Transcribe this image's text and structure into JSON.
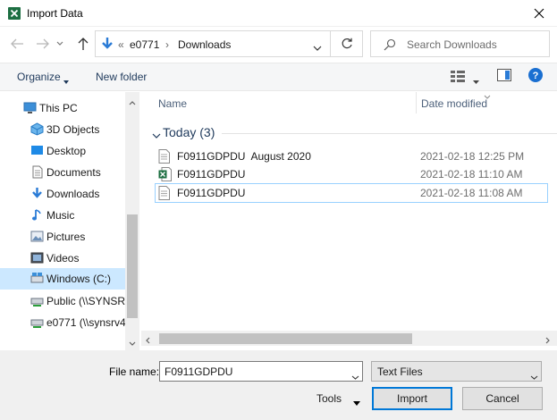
{
  "window": {
    "title": "Import Data"
  },
  "address": {
    "overflow": "«",
    "crumbs": [
      "e0771",
      "Downloads"
    ]
  },
  "search": {
    "placeholder": "Search Downloads"
  },
  "toolbar": {
    "organize": "Organize",
    "new_folder": "New folder"
  },
  "nav": {
    "items": [
      {
        "label": "This PC",
        "icon": "pc-icon"
      },
      {
        "label": "3D Objects",
        "icon": "cube-icon"
      },
      {
        "label": "Desktop",
        "icon": "desktop-icon"
      },
      {
        "label": "Documents",
        "icon": "document-icon"
      },
      {
        "label": "Downloads",
        "icon": "download-icon"
      },
      {
        "label": "Music",
        "icon": "music-icon"
      },
      {
        "label": "Pictures",
        "icon": "picture-icon"
      },
      {
        "label": "Videos",
        "icon": "video-icon"
      },
      {
        "label": "Windows (C:)",
        "icon": "drive-icon"
      },
      {
        "label": "Public (\\\\SYNSRV",
        "icon": "network-drive-icon"
      },
      {
        "label": "e0771 (\\\\synsrv4",
        "icon": "network-drive-icon"
      }
    ]
  },
  "list": {
    "headers": {
      "name": "Name",
      "date": "Date modified"
    },
    "group": "Today (3)",
    "files": [
      {
        "name": "F0911GDPDU  August 2020",
        "date": "2021-02-18 12:25 PM",
        "icon": "text-file-icon"
      },
      {
        "name": "F0911GDPDU",
        "date": "2021-02-18 11:10 AM",
        "icon": "excel-file-icon"
      },
      {
        "name": "F0911GDPDU",
        "date": "2021-02-18 11:08 AM",
        "icon": "text-file-icon"
      }
    ]
  },
  "footer": {
    "file_name_label": "File name:",
    "file_name_value": "F0911GDPDU",
    "file_type": "Text Files",
    "tools": "Tools",
    "import": "Import",
    "cancel": "Cancel"
  },
  "colors": {
    "accent": "#0078d7",
    "excel": "#1d6f42",
    "selected": "#cce8ff"
  }
}
